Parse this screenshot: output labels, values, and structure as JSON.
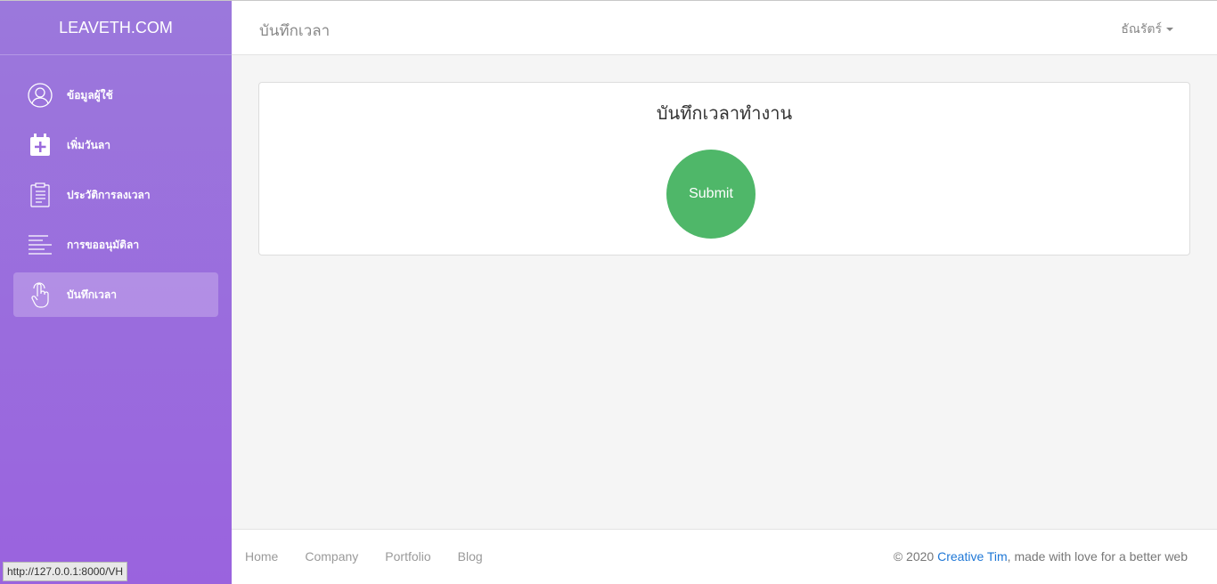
{
  "sidebar": {
    "brand": "LEAVETH.COM",
    "items": [
      {
        "label": "ข้อมูลผู้ใช้",
        "icon": "user-circle-icon"
      },
      {
        "label": "เพิ่มวันลา",
        "icon": "calendar-plus-icon"
      },
      {
        "label": "ประวัติการลงเวลา",
        "icon": "clipboard-icon"
      },
      {
        "label": "การขออนุมัติลา",
        "icon": "align-left-icon"
      },
      {
        "label": "บันทึกเวลา",
        "icon": "hand-pointer-icon",
        "active": true
      }
    ]
  },
  "status_bar": {
    "url": "http://127.0.0.1:8000/VH"
  },
  "header": {
    "title": "บันทึกเวลา",
    "user_name": "ธัณรัตร์"
  },
  "card": {
    "title": "บันทึกเวลาทำงาน",
    "submit_label": "Submit"
  },
  "footer": {
    "links": [
      "Home",
      "Company",
      "Portfolio",
      "Blog"
    ],
    "copyright_prefix": "© 2020 ",
    "copyright_link": "Creative Tim",
    "copyright_suffix": ", made with love for a better web"
  },
  "colors": {
    "sidebar_top": "#9b78dc",
    "sidebar_bottom": "#9a63de",
    "submit": "#4fb769",
    "link": "#1e77d6"
  }
}
